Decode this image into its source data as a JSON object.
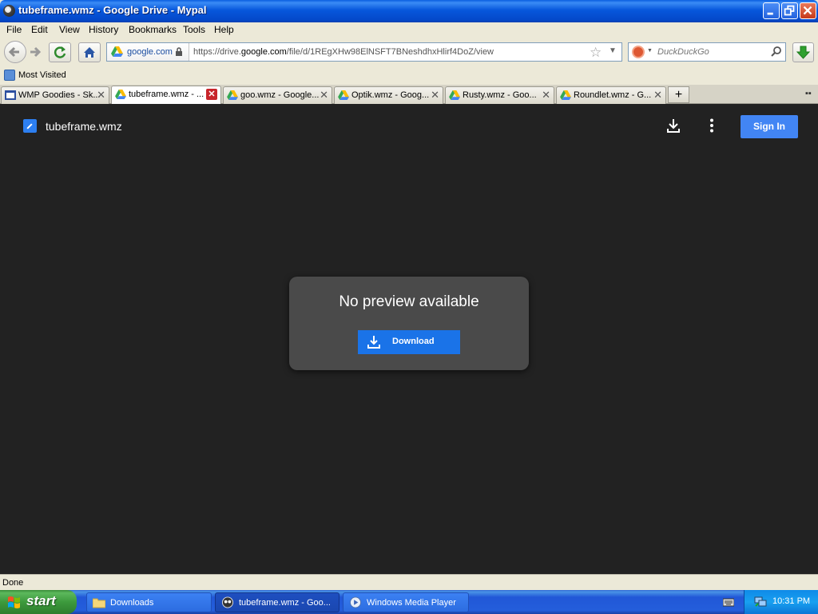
{
  "window": {
    "title": "tubeframe.wmz - Google Drive - Mypal"
  },
  "menu": [
    "File",
    "Edit",
    "View",
    "History",
    "Bookmarks",
    "Tools",
    "Help"
  ],
  "navbar": {
    "site_identity": "google.com",
    "url_prefix": "https://drive.",
    "url_domain": "google.com",
    "url_suffix": "/file/d/1REgXHw98ElNSFT7BNeshdhxHlirf4DoZ/view",
    "search_placeholder": "DuckDuckGo"
  },
  "bookmarks": {
    "most_visited": "Most Visited"
  },
  "tabs": [
    {
      "label": "WMP Goodies - Sk...",
      "icon": "page-icon"
    },
    {
      "label": "tubeframe.wmz - ...",
      "icon": "google-drive-icon",
      "active": true
    },
    {
      "label": "goo.wmz - Google...",
      "icon": "google-drive-icon"
    },
    {
      "label": "Optik.wmz - Goog...",
      "icon": "google-drive-icon"
    },
    {
      "label": "Rusty.wmz - Goo...",
      "icon": "google-drive-icon"
    },
    {
      "label": "Roundlet.wmz - G...",
      "icon": "google-drive-icon"
    }
  ],
  "page": {
    "file_name": "tubeframe.wmz",
    "sign_in": "Sign In",
    "no_preview": "No preview available",
    "download": "Download"
  },
  "status": {
    "text": "Done"
  },
  "taskbar": {
    "start": "start",
    "tasks": [
      {
        "label": "Downloads",
        "icon": "folder-icon"
      },
      {
        "label": "tubeframe.wmz - Goo...",
        "icon": "mypal-icon",
        "active": true
      },
      {
        "label": "Windows Media Player",
        "icon": "media-player-icon"
      }
    ],
    "clock": "10:31 PM"
  },
  "colors": {
    "page_background": "#222222",
    "card_background": "#4a4a4a",
    "download_button": "#1a73e8",
    "sign_in_button": "#4285f4"
  }
}
